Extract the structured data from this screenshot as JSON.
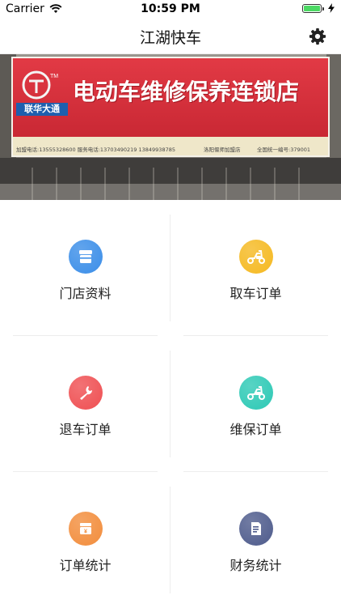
{
  "status_bar": {
    "carrier": "Carrier",
    "time": "10:59 PM",
    "battery_level": 1.0
  },
  "nav": {
    "title": "江湖快车"
  },
  "banner": {
    "logo_text": "联华大通",
    "shop_name": "电动车维修保养连锁店",
    "phone_line": "加盟电话:13555328600  服务电话:13703490219  13849938785",
    "location_line": "洛阳偃师加盟店",
    "number_line": "全国统一编号:379001"
  },
  "menu": [
    {
      "label": "门店资料",
      "icon": "store-icon",
      "color": "#3b8ee8"
    },
    {
      "label": "取车订单",
      "icon": "scooter-pickup-icon",
      "color": "#f5b921"
    },
    {
      "label": "退车订单",
      "icon": "wrench-icon",
      "color": "#ef4f52"
    },
    {
      "label": "维保订单",
      "icon": "scooter-maintenance-icon",
      "color": "#2dc9b5"
    },
    {
      "label": "订单统计",
      "icon": "order-stats-icon",
      "color": "#f28d3c"
    },
    {
      "label": "财务统计",
      "icon": "finance-doc-icon",
      "color": "#4e5b8c"
    }
  ]
}
